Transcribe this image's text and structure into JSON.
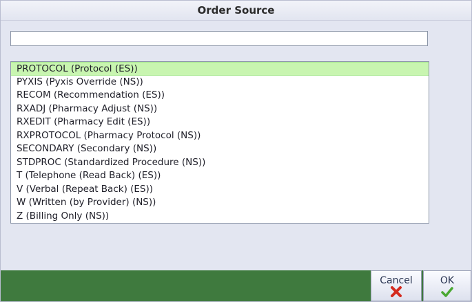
{
  "dialog": {
    "title": "Order Source"
  },
  "search": {
    "value": "",
    "placeholder": ""
  },
  "list": {
    "selected_index": 0,
    "items": [
      "PROTOCOL (Protocol (ES))",
      "PYXIS (Pyxis Override (NS))",
      "RECOM (Recommendation (ES))",
      "RXADJ (Pharmacy Adjust (NS))",
      "RXEDIT (Pharmacy Edit (ES))",
      "RXPROTOCOL (Pharmacy Protocol (NS))",
      "SECONDARY (Secondary (NS))",
      "STDPROC (Standardized Procedure (NS))",
      "T (Telephone (Read Back) (ES))",
      "V (Verbal (Repeat Back) (ES))",
      "W (Written (by Provider) (NS))",
      "Z (Billing Only (NS))"
    ]
  },
  "buttons": {
    "cancel_label": "Cancel",
    "cancel_icon": "red-x-icon",
    "ok_label": "OK",
    "ok_icon": "green-check-icon"
  },
  "colors": {
    "footer": "#3f7a3e",
    "selection": "#c8f5b0",
    "cancel_icon": "#d42a1e",
    "ok_icon": "#4aa832"
  }
}
